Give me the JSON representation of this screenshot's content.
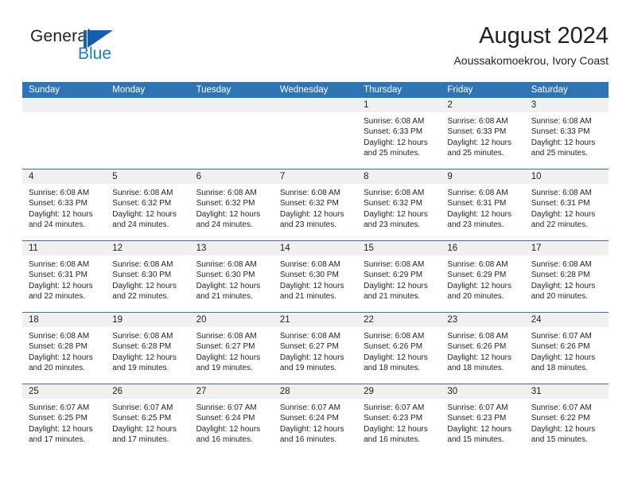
{
  "brand": {
    "word_one": "General",
    "word_two": "Blue",
    "mark": "triangle-flag-logo"
  },
  "header": {
    "month_title": "August 2024",
    "location": "Aoussakomoekrou, Ivory Coast"
  },
  "calendar": {
    "weekdays": [
      "Sunday",
      "Monday",
      "Tuesday",
      "Wednesday",
      "Thursday",
      "Friday",
      "Saturday"
    ],
    "header_color": "#2f74b5",
    "day_band_color": "#f0f0f0",
    "weeks": [
      [
        {
          "day": "",
          "lines": []
        },
        {
          "day": "",
          "lines": []
        },
        {
          "day": "",
          "lines": []
        },
        {
          "day": "",
          "lines": []
        },
        {
          "day": "1",
          "lines": [
            "Sunrise: 6:08 AM",
            "Sunset: 6:33 PM",
            "Daylight: 12 hours and 25 minutes."
          ]
        },
        {
          "day": "2",
          "lines": [
            "Sunrise: 6:08 AM",
            "Sunset: 6:33 PM",
            "Daylight: 12 hours and 25 minutes."
          ]
        },
        {
          "day": "3",
          "lines": [
            "Sunrise: 6:08 AM",
            "Sunset: 6:33 PM",
            "Daylight: 12 hours and 25 minutes."
          ]
        }
      ],
      [
        {
          "day": "4",
          "lines": [
            "Sunrise: 6:08 AM",
            "Sunset: 6:33 PM",
            "Daylight: 12 hours and 24 minutes."
          ]
        },
        {
          "day": "5",
          "lines": [
            "Sunrise: 6:08 AM",
            "Sunset: 6:32 PM",
            "Daylight: 12 hours and 24 minutes."
          ]
        },
        {
          "day": "6",
          "lines": [
            "Sunrise: 6:08 AM",
            "Sunset: 6:32 PM",
            "Daylight: 12 hours and 24 minutes."
          ]
        },
        {
          "day": "7",
          "lines": [
            "Sunrise: 6:08 AM",
            "Sunset: 6:32 PM",
            "Daylight: 12 hours and 23 minutes."
          ]
        },
        {
          "day": "8",
          "lines": [
            "Sunrise: 6:08 AM",
            "Sunset: 6:32 PM",
            "Daylight: 12 hours and 23 minutes."
          ]
        },
        {
          "day": "9",
          "lines": [
            "Sunrise: 6:08 AM",
            "Sunset: 6:31 PM",
            "Daylight: 12 hours and 23 minutes."
          ]
        },
        {
          "day": "10",
          "lines": [
            "Sunrise: 6:08 AM",
            "Sunset: 6:31 PM",
            "Daylight: 12 hours and 22 minutes."
          ]
        }
      ],
      [
        {
          "day": "11",
          "lines": [
            "Sunrise: 6:08 AM",
            "Sunset: 6:31 PM",
            "Daylight: 12 hours and 22 minutes."
          ]
        },
        {
          "day": "12",
          "lines": [
            "Sunrise: 6:08 AM",
            "Sunset: 6:30 PM",
            "Daylight: 12 hours and 22 minutes."
          ]
        },
        {
          "day": "13",
          "lines": [
            "Sunrise: 6:08 AM",
            "Sunset: 6:30 PM",
            "Daylight: 12 hours and 21 minutes."
          ]
        },
        {
          "day": "14",
          "lines": [
            "Sunrise: 6:08 AM",
            "Sunset: 6:30 PM",
            "Daylight: 12 hours and 21 minutes."
          ]
        },
        {
          "day": "15",
          "lines": [
            "Sunrise: 6:08 AM",
            "Sunset: 6:29 PM",
            "Daylight: 12 hours and 21 minutes."
          ]
        },
        {
          "day": "16",
          "lines": [
            "Sunrise: 6:08 AM",
            "Sunset: 6:29 PM",
            "Daylight: 12 hours and 20 minutes."
          ]
        },
        {
          "day": "17",
          "lines": [
            "Sunrise: 6:08 AM",
            "Sunset: 6:28 PM",
            "Daylight: 12 hours and 20 minutes."
          ]
        }
      ],
      [
        {
          "day": "18",
          "lines": [
            "Sunrise: 6:08 AM",
            "Sunset: 6:28 PM",
            "Daylight: 12 hours and 20 minutes."
          ]
        },
        {
          "day": "19",
          "lines": [
            "Sunrise: 6:08 AM",
            "Sunset: 6:28 PM",
            "Daylight: 12 hours and 19 minutes."
          ]
        },
        {
          "day": "20",
          "lines": [
            "Sunrise: 6:08 AM",
            "Sunset: 6:27 PM",
            "Daylight: 12 hours and 19 minutes."
          ]
        },
        {
          "day": "21",
          "lines": [
            "Sunrise: 6:08 AM",
            "Sunset: 6:27 PM",
            "Daylight: 12 hours and 19 minutes."
          ]
        },
        {
          "day": "22",
          "lines": [
            "Sunrise: 6:08 AM",
            "Sunset: 6:26 PM",
            "Daylight: 12 hours and 18 minutes."
          ]
        },
        {
          "day": "23",
          "lines": [
            "Sunrise: 6:08 AM",
            "Sunset: 6:26 PM",
            "Daylight: 12 hours and 18 minutes."
          ]
        },
        {
          "day": "24",
          "lines": [
            "Sunrise: 6:07 AM",
            "Sunset: 6:26 PM",
            "Daylight: 12 hours and 18 minutes."
          ]
        }
      ],
      [
        {
          "day": "25",
          "lines": [
            "Sunrise: 6:07 AM",
            "Sunset: 6:25 PM",
            "Daylight: 12 hours and 17 minutes."
          ]
        },
        {
          "day": "26",
          "lines": [
            "Sunrise: 6:07 AM",
            "Sunset: 6:25 PM",
            "Daylight: 12 hours and 17 minutes."
          ]
        },
        {
          "day": "27",
          "lines": [
            "Sunrise: 6:07 AM",
            "Sunset: 6:24 PM",
            "Daylight: 12 hours and 16 minutes."
          ]
        },
        {
          "day": "28",
          "lines": [
            "Sunrise: 6:07 AM",
            "Sunset: 6:24 PM",
            "Daylight: 12 hours and 16 minutes."
          ]
        },
        {
          "day": "29",
          "lines": [
            "Sunrise: 6:07 AM",
            "Sunset: 6:23 PM",
            "Daylight: 12 hours and 16 minutes."
          ]
        },
        {
          "day": "30",
          "lines": [
            "Sunrise: 6:07 AM",
            "Sunset: 6:23 PM",
            "Daylight: 12 hours and 15 minutes."
          ]
        },
        {
          "day": "31",
          "lines": [
            "Sunrise: 6:07 AM",
            "Sunset: 6:22 PM",
            "Daylight: 12 hours and 15 minutes."
          ]
        }
      ]
    ]
  }
}
